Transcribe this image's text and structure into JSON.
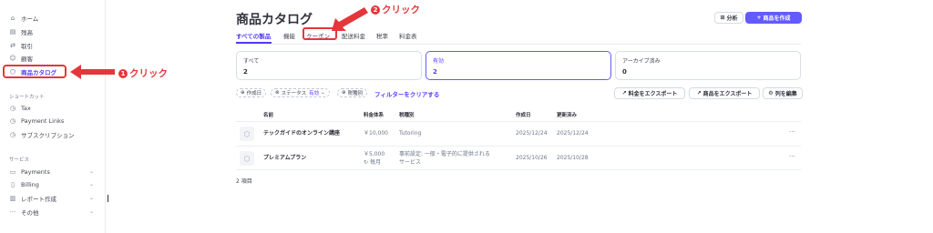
{
  "sidebar": {
    "items": [
      {
        "icon": "home-icon",
        "glyph": "⌂",
        "label": "ホーム"
      },
      {
        "icon": "balance-icon",
        "glyph": "▤",
        "label": "残高"
      },
      {
        "icon": "transactions-icon",
        "glyph": "⇄",
        "label": "取引"
      },
      {
        "icon": "customers-icon",
        "glyph": "☺",
        "label": "顧客"
      },
      {
        "icon": "product-catalog-icon",
        "glyph": "⬡",
        "label": "商品カタログ"
      }
    ],
    "shortcuts_title": "ショートカット",
    "shortcuts": [
      {
        "icon": "clock-icon",
        "glyph": "◷",
        "label": "Tax"
      },
      {
        "icon": "clock-icon",
        "glyph": "◷",
        "label": "Payment Links"
      },
      {
        "icon": "clock-icon",
        "glyph": "◷",
        "label": "サブスクリプション"
      }
    ],
    "services_title": "サービス",
    "services": [
      {
        "icon": "payments-icon",
        "glyph": "▭",
        "label": "Payments"
      },
      {
        "icon": "billing-icon",
        "glyph": "▯",
        "label": "Billing"
      },
      {
        "icon": "reports-icon",
        "glyph": "▥",
        "label": "レポート作成"
      },
      {
        "icon": "more-icon",
        "glyph": "···",
        "label": "その他"
      }
    ]
  },
  "annotations": {
    "step1": {
      "num": "1",
      "text": "クリック"
    },
    "step2": {
      "num": "2",
      "text": "クリック"
    },
    "color": "#e4373b"
  },
  "page": {
    "title": "商品カタログ",
    "tabs": [
      "すべての製品",
      "機能",
      "クーポン",
      "配送料金",
      "税率",
      "料金表"
    ],
    "buttons": {
      "analysis": "分析",
      "create_product": "商品を作成"
    }
  },
  "filter_cards": [
    {
      "label": "すべて",
      "count": "2"
    },
    {
      "label": "有効",
      "count": "2"
    },
    {
      "label": "アーカイブ済み",
      "count": "0"
    }
  ],
  "filters": {
    "created": "作成日",
    "status": "ステータス",
    "status_value": "有効",
    "tax_category": "税種別",
    "clear": "フィルターをクリアする"
  },
  "actions": {
    "export_prices": "料金をエクスポート",
    "export_products": "商品をエクスポート",
    "edit_columns": "列を編集"
  },
  "table": {
    "headers": [
      "名前",
      "料金体系",
      "税種別",
      "作成日",
      "更新済み"
    ],
    "rows": [
      {
        "name": "テックガイドのオンライン講座",
        "price": "￥10,000",
        "price_sub": "",
        "tax": "Tutoring",
        "tax_sub": "",
        "created": "2025/12/24",
        "updated": "2025/12/24"
      },
      {
        "name": "プレミアムプラン",
        "price": "￥5,000",
        "price_sub": "毎月",
        "tax": "事前設定: 一般・電子的に提供される",
        "tax_sub": "サービス",
        "created": "2025/10/26",
        "updated": "2025/10/28"
      }
    ],
    "footer": "2 項目"
  },
  "colors": {
    "accent": "#533afd",
    "primary_button": "#635bff",
    "annotation": "#e4373b"
  }
}
